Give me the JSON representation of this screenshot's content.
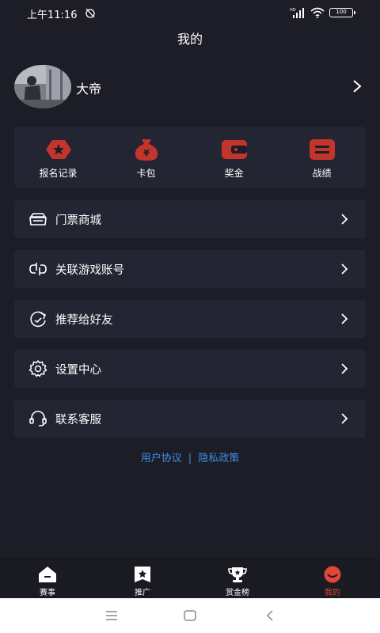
{
  "status": {
    "time": "上午11:16",
    "battery": "100"
  },
  "page": {
    "title": "我的"
  },
  "profile": {
    "name": "大帝"
  },
  "quick_actions": [
    {
      "label": "报名记录",
      "icon": "signup-record-icon"
    },
    {
      "label": "卡包",
      "icon": "card-bag-icon"
    },
    {
      "label": "奖金",
      "icon": "bonus-wallet-icon"
    },
    {
      "label": "战绩",
      "icon": "battle-record-icon"
    }
  ],
  "menu": [
    {
      "label": "门票商城",
      "icon": "ticket-mall-icon"
    },
    {
      "label": "关联游戏账号",
      "icon": "link-account-icon"
    },
    {
      "label": "推荐给好友",
      "icon": "recommend-icon"
    },
    {
      "label": "设置中心",
      "icon": "settings-gear-icon"
    },
    {
      "label": "联系客服",
      "icon": "headset-icon"
    }
  ],
  "links": {
    "user_agreement": "用户协议",
    "separator": "|",
    "privacy_policy": "隐私政策"
  },
  "tabs": [
    {
      "label": "赛事",
      "icon": "event-home-icon"
    },
    {
      "label": "推广",
      "icon": "promote-badge-icon"
    },
    {
      "label": "赏金榜",
      "icon": "trophy-icon"
    },
    {
      "label": "我的",
      "icon": "mine-face-icon",
      "active": true
    }
  ],
  "colors": {
    "background": "#1c1d26",
    "card": "#232532",
    "accent_red": "#e4453a",
    "link_blue": "#3b8ee8"
  }
}
